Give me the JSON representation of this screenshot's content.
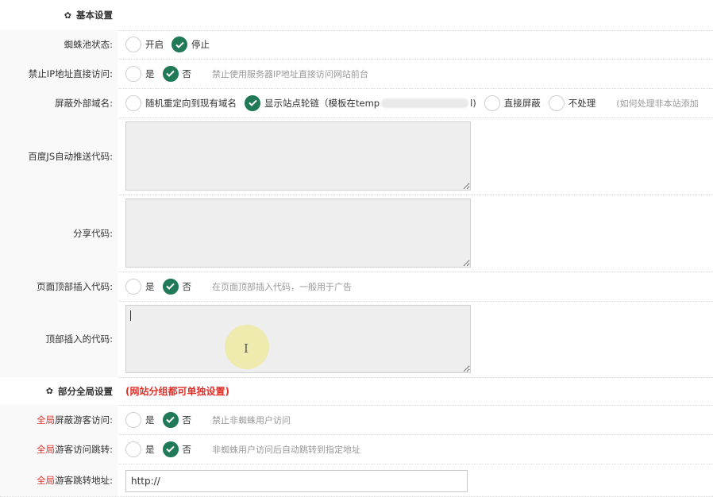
{
  "sections": {
    "basic": {
      "title": "基本设置",
      "icon": "gear-icon"
    },
    "global": {
      "title": "部分全局设置",
      "note": "(网站分组都可单独设置)",
      "icon": "gear-icon"
    }
  },
  "rows": {
    "spider_pool_status": {
      "label": "蜘蛛池状态:",
      "options": [
        "开启",
        "停止"
      ],
      "selected": 1
    },
    "block_ip_access": {
      "label": "禁止IP地址直接访问:",
      "options": [
        "是",
        "否"
      ],
      "selected": 1,
      "hint": "禁止使用服务器IP地址直接访问网站前台"
    },
    "block_external_domain": {
      "label": "屏蔽外部域名:",
      "options": [
        "随机重定向到现有域名",
        "显示站点轮链（模板在temp",
        "直接屏蔽",
        "不处理"
      ],
      "option_tail": "l)",
      "selected": 1,
      "hint": "(如何处理非本站添加"
    },
    "baidu_js": {
      "label": "百度JS自动推送代码:",
      "value": ""
    },
    "share_code": {
      "label": "分享代码:",
      "value": ""
    },
    "top_insert_code": {
      "label": "页面顶部插入代码:",
      "options": [
        "是",
        "否"
      ],
      "selected": 1,
      "hint": "在页面顶部插入代码，一般用于广告"
    },
    "top_insert_content": {
      "label": "顶部插入的代码:",
      "value": ""
    },
    "block_visitors": {
      "label_prefix": "全局",
      "label_rest": "屏蔽游客访问:",
      "options": [
        "是",
        "否"
      ],
      "selected": 1,
      "hint": "禁止非蜘蛛用户访问"
    },
    "visitor_redirect": {
      "label_prefix": "全局",
      "label_rest": "游客访问跳转:",
      "options": [
        "是",
        "否"
      ],
      "selected": 1,
      "hint": "非蜘蛛用户访问后自动跳转到指定地址"
    },
    "redirect_url": {
      "label_prefix": "全局",
      "label_rest": "游客跳转地址:",
      "value": "http://"
    }
  },
  "colors": {
    "check_green": "#1f7a55",
    "accent_red": "#e0312a",
    "label_bg": "#f9f9f9",
    "textarea_bg": "#eeeeee"
  }
}
